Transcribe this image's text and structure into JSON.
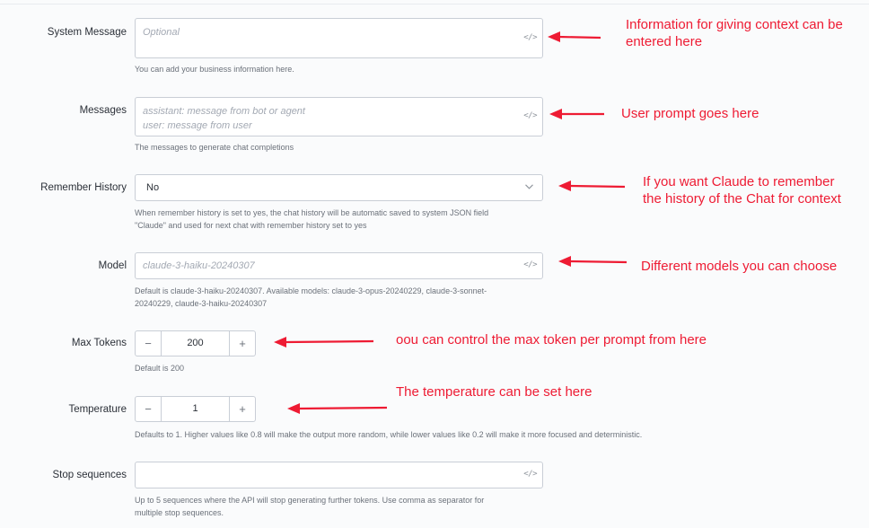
{
  "form": {
    "system_message": {
      "label": "System Message",
      "placeholder": "Optional",
      "help": "You can add your business information here."
    },
    "messages": {
      "label": "Messages",
      "placeholder_line1": "assistant: message from bot or agent",
      "placeholder_line2": "user: message from user",
      "help": "The messages to generate chat completions"
    },
    "remember_history": {
      "label": "Remember History",
      "value": "No",
      "help_line1": "When remember history is set to yes, the chat history will be automatic saved to system JSON field",
      "help_line2": "\"Claude\" and used for next chat with remember history set to yes"
    },
    "model": {
      "label": "Model",
      "placeholder": "claude-3-haiku-20240307",
      "help_line1": "Default is claude-3-haiku-20240307. Available models: claude-3-opus-20240229, claude-3-sonnet-",
      "help_line2": "20240229, claude-3-haiku-20240307"
    },
    "max_tokens": {
      "label": "Max Tokens",
      "value": "200",
      "help": "Default is 200"
    },
    "temperature": {
      "label": "Temperature",
      "value": "1",
      "help": "Defaults to 1. Higher values like 0.8 will make the output more random, while lower values like 0.2 will make it more focused and deterministic."
    },
    "stop_sequences": {
      "label": "Stop sequences",
      "help_line1": "Up to 5 sequences where the API will stop generating further tokens. Use comma as separator for",
      "help_line2": "multiple stop sequences."
    },
    "code_icon_glyph": "</>",
    "stepper_minus": "−",
    "stepper_plus": "+"
  },
  "annotations": {
    "system_message_line1": "Information for giving context can be",
    "system_message_line2": "entered here",
    "messages": "User prompt goes here",
    "remember_line1": "If you want Claude to remember",
    "remember_line2": "the history of the Chat for context",
    "model": "Different models you can choose",
    "max_tokens": "oou can control the max token per prompt from here",
    "temperature": "The temperature can be set here"
  },
  "icons": [
    "code-icon",
    "chevron-down-icon",
    "minus-icon",
    "plus-icon",
    "arrow-left-icon"
  ],
  "colors": {
    "annotation": "#ee1b33",
    "border": "#c9ced6",
    "placeholder": "#a3a9b3"
  }
}
